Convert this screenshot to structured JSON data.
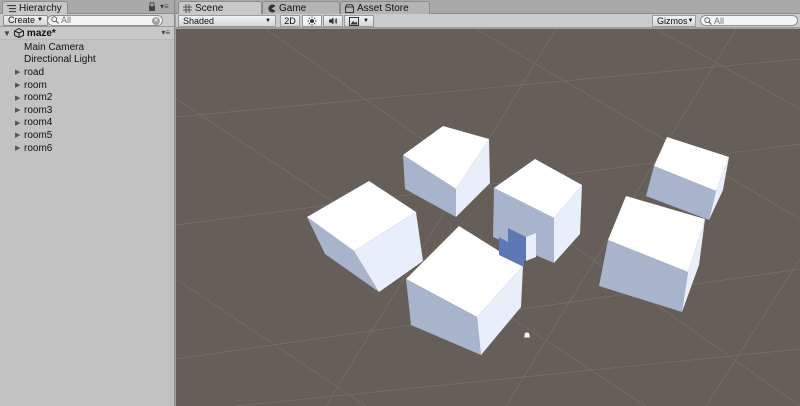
{
  "hierarchy": {
    "tab_label": "Hierarchy",
    "create_label": "Create",
    "search_placeholder": "All",
    "scene_name": "maze*",
    "items": [
      {
        "label": "Main Camera",
        "expandable": false
      },
      {
        "label": "Directional Light",
        "expandable": false
      },
      {
        "label": "road",
        "expandable": true
      },
      {
        "label": "room",
        "expandable": true
      },
      {
        "label": "room2",
        "expandable": true
      },
      {
        "label": "room3",
        "expandable": true
      },
      {
        "label": "room4",
        "expandable": true
      },
      {
        "label": "room5",
        "expandable": true
      },
      {
        "label": "room6",
        "expandable": true
      }
    ]
  },
  "tabs": [
    {
      "label": "Scene",
      "icon": "grid-icon",
      "active": true
    },
    {
      "label": "Game",
      "icon": "pacman-icon",
      "active": false
    },
    {
      "label": "Asset Store",
      "icon": "store-icon",
      "active": false
    }
  ],
  "scene_toolbar": {
    "shading_mode": "Shaded",
    "mode_2d_label": "2D",
    "gizmos_label": "Gizmos",
    "search_placeholder": "All",
    "icons": [
      "sun-icon",
      "audio-icon",
      "image-effects-icon"
    ]
  },
  "colors": {
    "viewport_bg": "#665e59",
    "grid_line": "#7a746f",
    "cube_top": "#ffffff",
    "cube_side_light": "#e8eefa",
    "cube_side_dark": "#a8b3cc",
    "selection_blue": "#5d79b5"
  }
}
